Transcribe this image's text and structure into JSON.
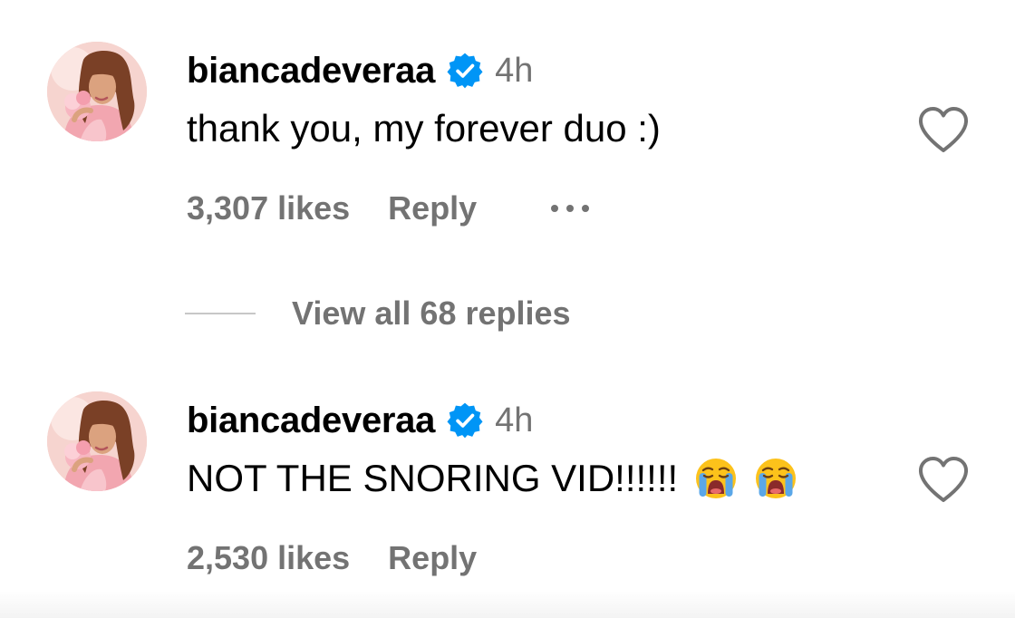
{
  "comments": [
    {
      "username": "biancadeveraa",
      "verified_icon": "verified-badge-icon",
      "time": "4h",
      "text": "thank you, my forever duo :)",
      "emojis": [],
      "likes": "3,307 likes",
      "reply_label": "Reply",
      "has_more_menu": true,
      "view_replies": "View all 68 replies"
    },
    {
      "username": "biancadeveraa",
      "verified_icon": "verified-badge-icon",
      "time": "4h",
      "text": "NOT THE SNORING VID!!!!!!",
      "emojis": [
        "loudly-crying-face-emoji",
        "loudly-crying-face-emoji"
      ],
      "likes": "2,530 likes",
      "reply_label": "Reply",
      "has_more_menu": false
    }
  ],
  "colors": {
    "text": "#000000",
    "secondary": "#737373",
    "verified": "#0095f6",
    "divider": "#c7c7c7"
  }
}
